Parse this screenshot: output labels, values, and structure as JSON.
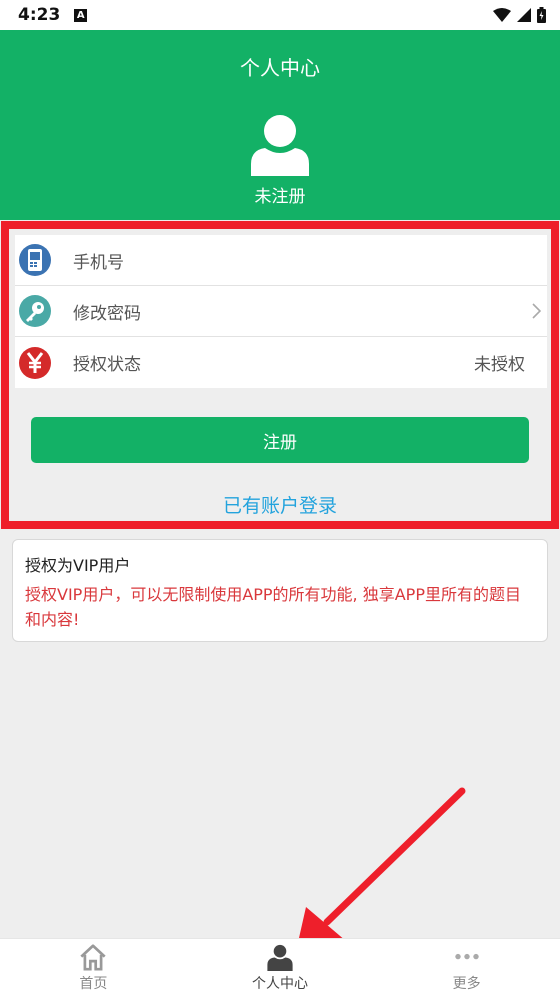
{
  "status_bar": {
    "time": "4:23",
    "badge": "A"
  },
  "header": {
    "title": "个人中心",
    "registration_status": "未注册"
  },
  "account_list": {
    "items": [
      {
        "label": "手机号",
        "value": "",
        "icon": "phone-icon",
        "icon_color": "#3b73b2"
      },
      {
        "label": "修改密码",
        "value": "",
        "icon": "key-icon",
        "icon_color": "#4aa9a6"
      },
      {
        "label": "授权状态",
        "value": "未授权",
        "icon": "yuan-icon",
        "icon_color": "#d42a2a"
      }
    ]
  },
  "register_button": {
    "label": "注册"
  },
  "login_link": {
    "label": "已有账户登录"
  },
  "vip_card": {
    "title": "授权为VIP用户",
    "description": "授权VIP用户，可以无限制使用APP的所有功能, 独享APP里所有的题目和内容!"
  },
  "bottom_nav": {
    "items": [
      {
        "label": "首页",
        "icon": "home-icon"
      },
      {
        "label": "个人中心",
        "icon": "user-icon"
      },
      {
        "label": "更多",
        "icon": "more-icon"
      }
    ],
    "active": "个人中心"
  },
  "colors": {
    "primary_green": "#13b166",
    "highlight_red": "#ee1f2b",
    "link_blue": "#23a3dd",
    "vip_red": "#d9383c"
  }
}
